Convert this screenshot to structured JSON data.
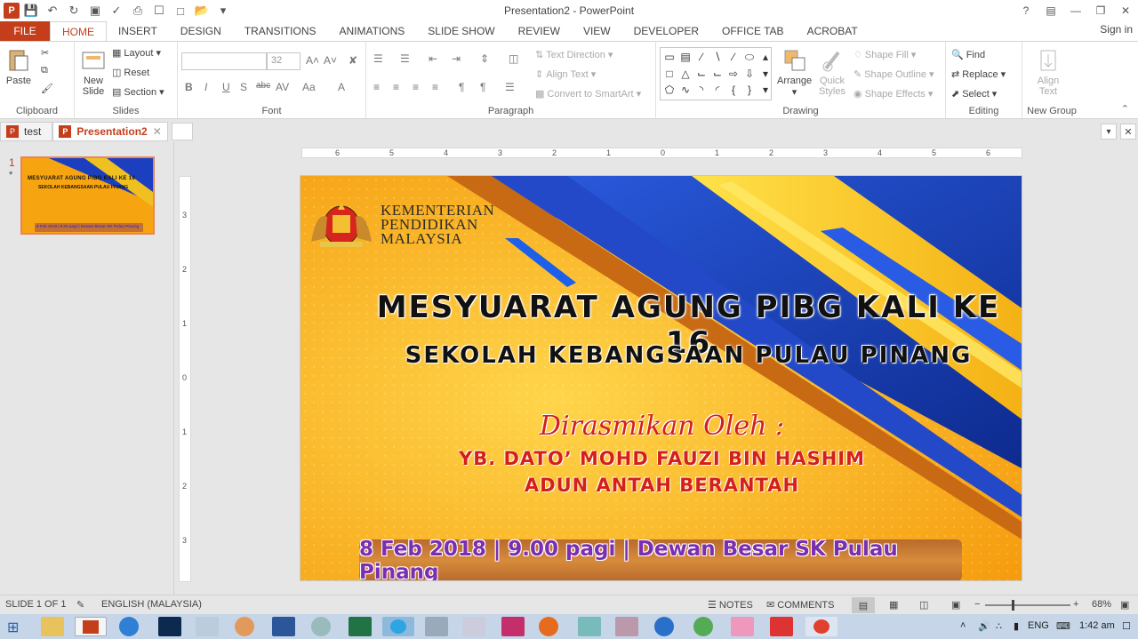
{
  "window": {
    "title": "Presentation2 - PowerPoint",
    "help": "?",
    "signin": "Sign in"
  },
  "tabs": [
    {
      "label": "FILE"
    },
    {
      "label": "HOME"
    },
    {
      "label": "INSERT"
    },
    {
      "label": "DESIGN"
    },
    {
      "label": "TRANSITIONS"
    },
    {
      "label": "ANIMATIONS"
    },
    {
      "label": "SLIDE SHOW"
    },
    {
      "label": "REVIEW"
    },
    {
      "label": "VIEW"
    },
    {
      "label": "DEVELOPER"
    },
    {
      "label": "OFFICE TAB"
    },
    {
      "label": "ACROBAT"
    }
  ],
  "ribbon": {
    "clipboard": {
      "paste": "Paste",
      "label": "Clipboard"
    },
    "slides": {
      "new_slide": "New Slide",
      "layout": "Layout",
      "reset": "Reset",
      "section": "Section",
      "label": "Slides"
    },
    "font": {
      "size": "32",
      "label": "Font"
    },
    "paragraph": {
      "text_direction": "Text Direction",
      "align_text": "Align Text",
      "convert": "Convert to SmartArt",
      "label": "Paragraph"
    },
    "drawing": {
      "arrange": "Arrange",
      "quick_styles": "Quick Styles",
      "shape_fill": "Shape Fill",
      "shape_outline": "Shape Outline",
      "shape_effects": "Shape Effects",
      "label": "Drawing"
    },
    "editing": {
      "find": "Find",
      "replace": "Replace",
      "select": "Select",
      "label": "Editing"
    },
    "newgroup": {
      "align_text": "Align Text",
      "label": "New Group"
    }
  },
  "doc_tabs": [
    {
      "label": "test"
    },
    {
      "label": "Presentation2"
    }
  ],
  "thumbs": {
    "number": "1",
    "star": "*",
    "title": "MESYUARAT AGUNG PIBG KALI KE 16",
    "subtitle": "SEKOLAH KEBANGSAAN PULAU PINANG",
    "footer": "8 Feb 2018 | 9.00 pagi | Dewan Besar SK Pulau Pinang"
  },
  "ruler": {
    "h": [
      "6",
      "5",
      "4",
      "3",
      "2",
      "1",
      "0",
      "1",
      "2",
      "3",
      "4",
      "5",
      "6"
    ],
    "v": [
      "3",
      "2",
      "1",
      "0",
      "1",
      "2",
      "3"
    ]
  },
  "slide": {
    "logo_lines": [
      "KEMENTERIAN",
      "PENDIDIKAN",
      "MALAYSIA"
    ],
    "title": "MESYUARAT AGUNG PIBG KALI KE 16",
    "subtitle": "SEKOLAH KEBANGSAAN PULAU PINANG",
    "officiated": "Dirasmikan Oleh :",
    "person": "YB. DATO’ MOHD FAUZI BIN HASHIM",
    "role": "ADUN ANTAH BERANTAH",
    "footer": "8 Feb 2018 | 9.00 pagi | Dewan Besar SK Pulau Pinang"
  },
  "status": {
    "slide_of": "SLIDE 1 OF 1",
    "language": "ENGLISH (MALAYSIA)",
    "notes": "NOTES",
    "comments": "COMMENTS",
    "zoom_minus": "−",
    "zoom_plus": "+",
    "zoom": "68%"
  },
  "taskbar": {
    "lang": "ENG",
    "time": "1:42 am"
  },
  "colors": {
    "accent": "#c43e1c",
    "slide_orange": "#f7a411",
    "slide_blue": "#1b3fbf"
  }
}
